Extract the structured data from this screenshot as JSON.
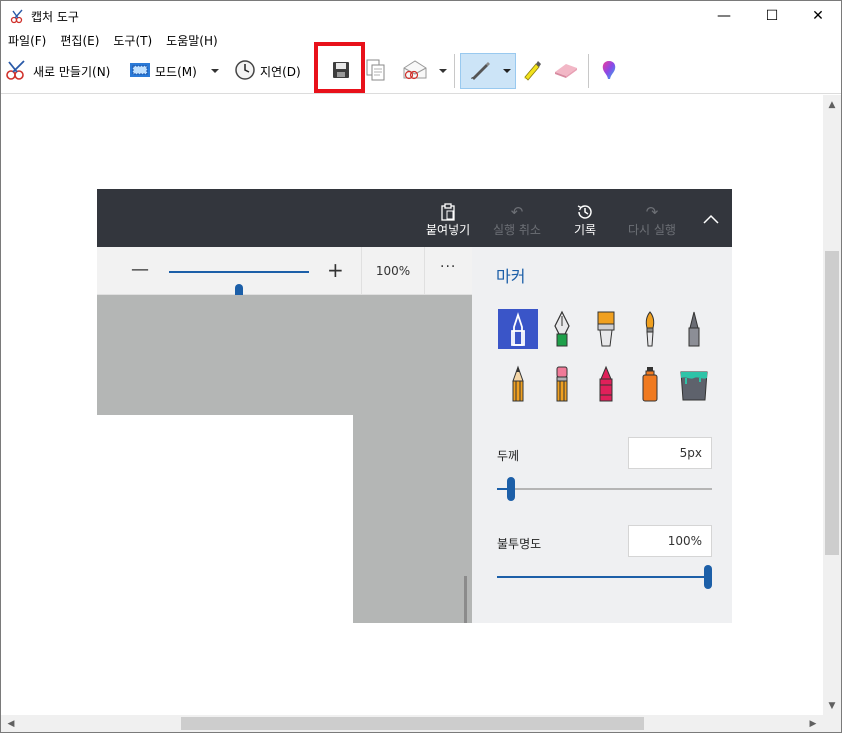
{
  "window": {
    "title": "캡처 도구",
    "controls": {
      "minimize": "—",
      "maximize": "☐",
      "close": "✕"
    }
  },
  "menu": [
    "파일(F)",
    "편집(E)",
    "도구(T)",
    "도움말(H)"
  ],
  "toolbar": {
    "new_label": "새로 만들기(N)",
    "mode_label": "모드(M)",
    "delay_label": "지연(D)",
    "icons": [
      "scissors-icon",
      "mode-rect-icon",
      "clock-icon",
      "save-icon",
      "copy-icon",
      "send-email-icon",
      "pen-icon",
      "highlighter-icon",
      "eraser-icon",
      "paint3d-icon"
    ],
    "highlighted": "save-icon",
    "highlight_color": "#e8111a"
  },
  "capture": {
    "topbar": {
      "paste": "붙여넣기",
      "undo": "실행 취소",
      "history": "기록",
      "redo": "다시 실행"
    },
    "zoom": {
      "value": "100%",
      "more": "···",
      "level": 0.5
    },
    "panel": {
      "title": "마커",
      "thickness_label": "두께",
      "thickness_value": "5px",
      "thickness_level": 0.05,
      "opacity_label": "불투명도",
      "opacity_value": "100%",
      "opacity_level": 1.0,
      "tools": [
        "marker",
        "calligraphy-pen",
        "oil-brush",
        "watercolor-brush",
        "pencil-gray",
        "pencil",
        "eraser-pencil",
        "crayon",
        "spray-can",
        "fill-bucket"
      ]
    },
    "colors": {
      "dark_bar": "#33363d",
      "accent": "#1c5fa8",
      "panel_bg": "#eff0f2",
      "canvas_gray": "#b4b6b5"
    }
  }
}
